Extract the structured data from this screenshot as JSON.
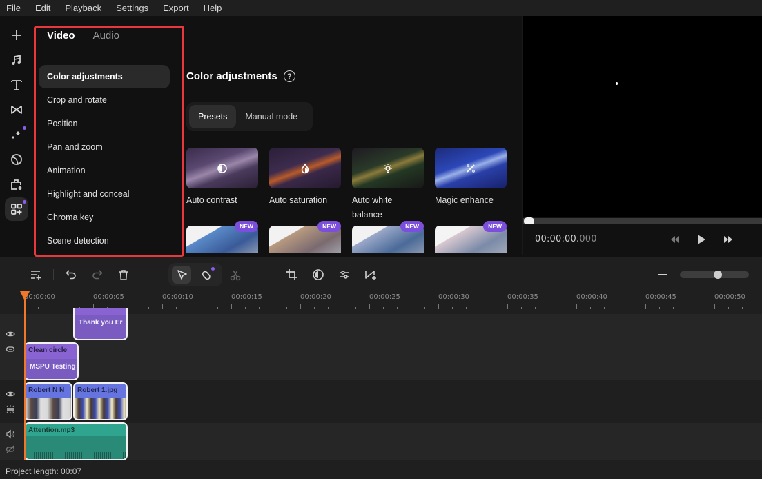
{
  "menu": [
    "File",
    "Edit",
    "Playback",
    "Settings",
    "Export",
    "Help"
  ],
  "left_toolbar": [
    {
      "icon": "add-icon",
      "label": "Import"
    },
    {
      "icon": "music-icon",
      "label": "Music"
    },
    {
      "icon": "text-icon",
      "label": "Titles"
    },
    {
      "icon": "transitions-icon",
      "label": "Transitions"
    },
    {
      "icon": "effects-icon",
      "label": "Effects",
      "dot": true
    },
    {
      "icon": "stickers-icon",
      "label": "Stickers"
    },
    {
      "icon": "store-icon",
      "label": "Store"
    },
    {
      "icon": "more-tools-icon",
      "label": "More tools",
      "dot": true,
      "active": true
    }
  ],
  "tabs": {
    "video": "Video",
    "audio": "Audio",
    "active": "Video"
  },
  "categories": [
    {
      "label": "Color adjustments",
      "active": true
    },
    {
      "label": "Crop and rotate"
    },
    {
      "label": "Position"
    },
    {
      "label": "Pan and zoom"
    },
    {
      "label": "Animation"
    },
    {
      "label": "Highlight and conceal"
    },
    {
      "label": "Chroma key"
    },
    {
      "label": "Scene detection"
    }
  ],
  "panel": {
    "title": "Color adjustments",
    "help_icon": "?",
    "modes": [
      "Presets",
      "Manual mode"
    ],
    "active_mode": "Presets",
    "presets": [
      {
        "label": "Auto contrast",
        "icon": "contrast-icon"
      },
      {
        "label": "Auto saturation",
        "icon": "drop-icon"
      },
      {
        "label": "Auto white balance",
        "icon": "bulb-icon"
      },
      {
        "label": "Magic enhance",
        "icon": "magic-wand-icon"
      }
    ],
    "new_presets": [
      {
        "badge": "NEW"
      },
      {
        "badge": "NEW"
      },
      {
        "badge": "NEW"
      },
      {
        "badge": "NEW"
      }
    ]
  },
  "player": {
    "timecode_main": "00:00:00.",
    "timecode_ms": "000",
    "progress": 0
  },
  "timeline": {
    "zoom_level": 0.55,
    "ruler": [
      "00:00:00",
      "00:00:05",
      "00:00:10",
      "00:00:15",
      "00:00:20",
      "00:00:25",
      "00:00:30",
      "00:00:35",
      "00:00:40",
      "00:00:45",
      "00:00:50"
    ],
    "clips": {
      "title1": "Thank you Er",
      "title2_header": "Clean circle",
      "title2_body": "MSPU Testing",
      "video1": "Robert  N N",
      "video2": "Robert 1.jpg",
      "audio1": "Attention.mp3"
    }
  },
  "status": {
    "project_length": "Project length: 00:07"
  },
  "colors": {
    "accent": "#8a5cf0",
    "highlight_box": "#e8383d",
    "playhead": "#f0782a",
    "title_clip": "#8a63d2",
    "video_clip": "#6674e0",
    "audio_clip": "#2fa58f"
  }
}
